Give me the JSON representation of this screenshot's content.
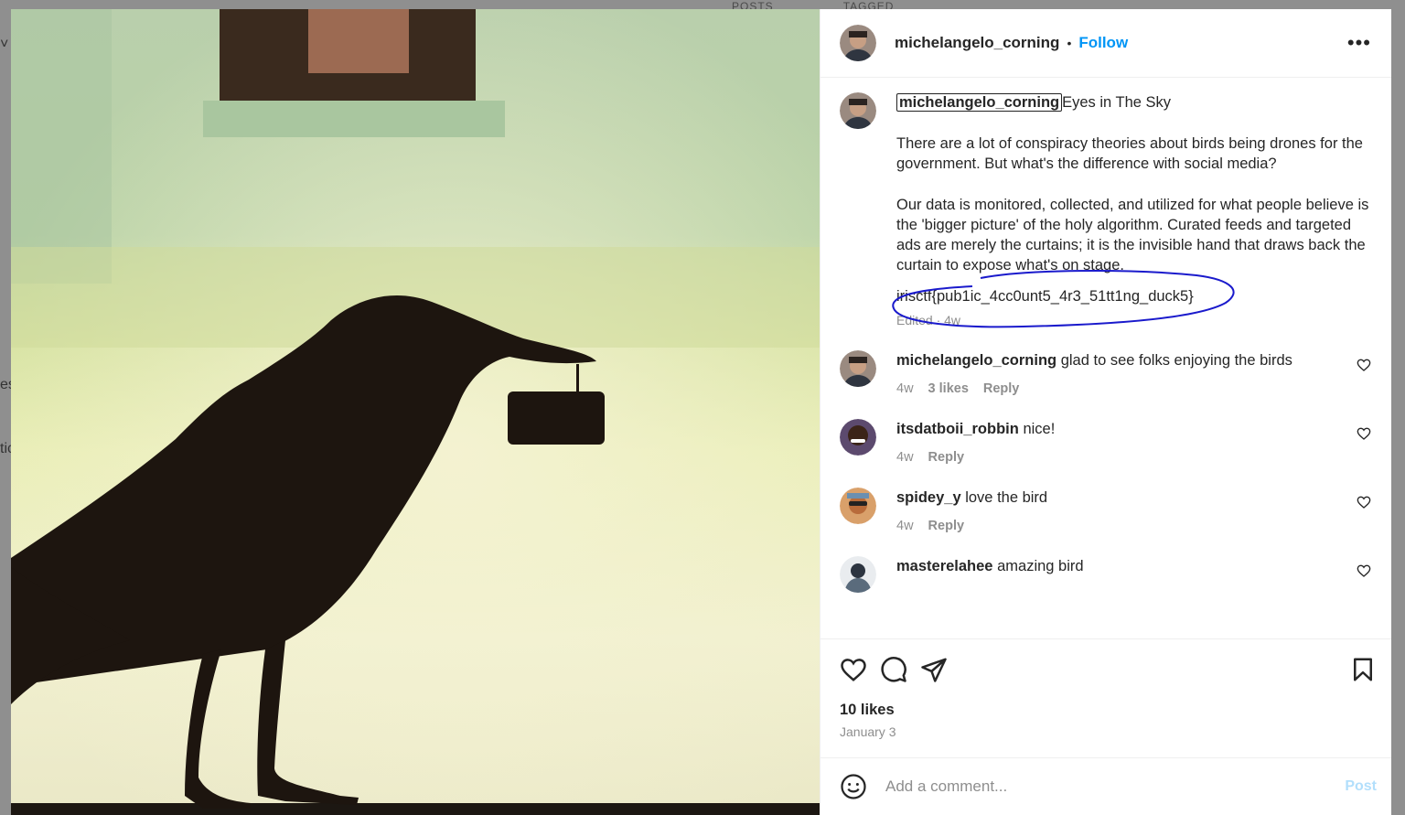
{
  "background": {
    "tabs": [
      "POSTS",
      "TAGGED"
    ],
    "edge_text": [
      "˅",
      "es",
      "tic"
    ]
  },
  "post": {
    "author": "michelangelo_corning",
    "follow_label": "Follow",
    "dot": "•",
    "more_label": "•••",
    "caption": {
      "username": "michelangelo_corning",
      "title": "Eyes in The Sky",
      "paragraph1": "There are a lot of conspiracy theories about birds being drones for the government. But what's the difference with social media?",
      "paragraph2": "Our data is monitored, collected, and utilized for what people believe is the 'bigger picture' of the holy algorithm. Curated feeds and targeted ads are merely the curtains; it is the invisible hand that draws back the curtain to expose what's on stage.",
      "flag": "irisctf{pub1ic_4cc0unt5_4r3_51tt1ng_duck5}",
      "meta": "Edited · 4w"
    },
    "comments": [
      {
        "user": "michelangelo_corning",
        "text": "glad to see folks enjoying the birds",
        "time": "4w",
        "likes": "3 likes",
        "reply": "Reply"
      },
      {
        "user": "itsdatboii_robbin",
        "text": "nice!",
        "time": "4w",
        "reply": "Reply"
      },
      {
        "user": "spidey_y",
        "text": "love the bird",
        "time": "4w",
        "reply": "Reply"
      },
      {
        "user": "masterelahee",
        "text": "amazing bird"
      }
    ],
    "likes": "10 likes",
    "date": "January 3",
    "add_comment_placeholder": "Add a comment...",
    "post_label": "Post"
  },
  "colors": {
    "accent": "#0095f6",
    "annotation": "#1a1acc",
    "post_disabled": "#b2dffc"
  },
  "icons": [
    "more-icon",
    "heart-icon",
    "comment-icon",
    "share-icon",
    "bookmark-icon",
    "emoji-icon"
  ]
}
